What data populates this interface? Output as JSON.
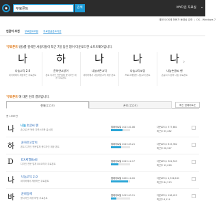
{
  "header": {
    "search_value": "무료폰트",
    "search_button": "검색",
    "user_label": "MY다운 자료실",
    "colors": {
      "bar": "#2c2c2c",
      "accent": "#1c9ad6"
    }
  },
  "ad": {
    "left": "데이터 OS에 전문가 동영상 강좌",
    "sep": "|",
    "right": "OS - Windows 7"
  },
  "recommend": {
    "label": "연관어 추천",
    "keywords": [
      "무료폰트모음",
      "무료한글폰트다운"
    ]
  },
  "section_title": {
    "quote": "'무료폰트'",
    "rest": "(을)를 검색한 사용자들이 최근 7일 동안 많이 다운로드한 소프트웨어입니다."
  },
  "cards": [
    {
      "glyph": "나",
      "title": "나눔고딕 2.0",
      "desc": "네이버에서 제공하는 무료폰트"
    },
    {
      "glyph": "하",
      "title": "윤하얀고양이",
      "desc": "폰트 디자인 전문업체 윤디자인 제공 무료폰트"
    },
    {
      "glyph": "나",
      "title": "나눔바른고딕",
      "desc": "네이버에서 나눔바른고딕 제공 폰트"
    },
    {
      "glyph": "나",
      "title": "나눔고딕코딩",
      "desc": "프로그래밍용 나눔고딕 폰트"
    },
    {
      "glyph": "나",
      "title": "나눔손글씨 펜",
      "desc": "손글씨 느낌의 나눔 무료폰트"
    }
  ],
  "section2": {
    "quote": "'무료폰트'",
    "rest": "에 대한 검색 결과입니다."
  },
  "tabs": [
    {
      "label": "전체",
      "count": "(1559)"
    },
    {
      "label": "폰트",
      "count": "(1559)"
    }
  ],
  "sort_label": "최신 업데이트순",
  "result_count": "총 1559건",
  "rows": [
    {
      "glyph": "나",
      "tag": "나눔",
      "name": "손글씨 펜",
      "desc": "손으로 쓴 듯한 자연스러운 글씨체",
      "date_label": "업데이트일",
      "date": "2013.01.06",
      "level": 0.62,
      "dl_label": "다운로드수",
      "dl": "377,661",
      "dl2": "최근주 55,282"
    },
    {
      "glyph": "하",
      "tag": "",
      "name": "윤하얀고양이",
      "desc": "폰트 디자인 전문업체 윤디자인 제공 폰트",
      "date_label": "업데이트일",
      "date": "2013.05.21",
      "level": 0.55,
      "dl_label": "다운로드수",
      "dl": "815,362",
      "dl2": "최근주 28,947"
    },
    {
      "glyph": "D",
      "tag": "",
      "name": "DX세필Bold",
      "desc": "디자인 전문 업체 DX코리아 무료폰트",
      "date_label": "업데이트일",
      "date": "2013.12.17",
      "level": 0.4,
      "dl_label": "다운로드수",
      "dl": "301,543",
      "dl2": "최근주 12,018"
    },
    {
      "glyph": "나",
      "tag": "",
      "name": "나눔고딕 2.0",
      "desc": "네이버에서 제공하는 무료폰트",
      "date_label": "업데이트일",
      "date": "2009.10.20",
      "level": 0.88,
      "dl_label": "다운로드수",
      "dl": "4,356,181",
      "dl2": "최근주 84,213"
    },
    {
      "glyph": "바",
      "tag": "",
      "name": "윤바탕체",
      "desc": "윤디자인 제공 바탕 무료폰트",
      "date_label": "업데이트일",
      "date": "2013.03.11",
      "level": 0.3,
      "dl_label": "다운로드수",
      "dl": "198,422",
      "dl2": "최근주 6,114"
    }
  ]
}
